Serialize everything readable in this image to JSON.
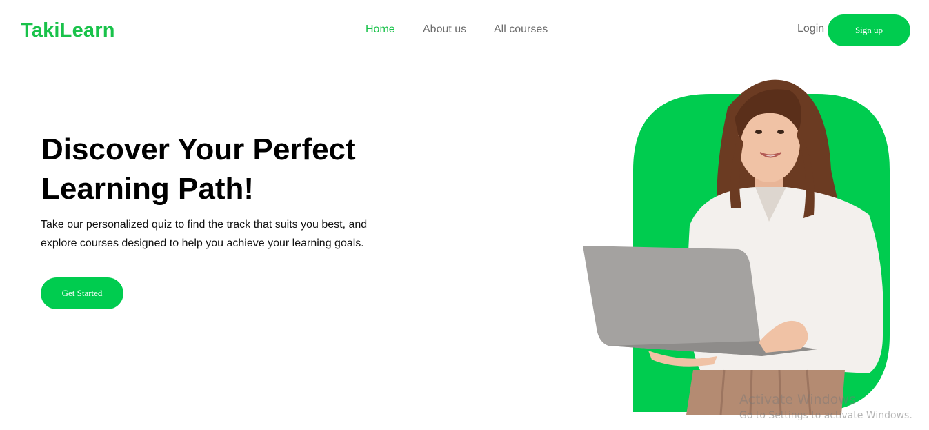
{
  "brand": {
    "name": "TakiLearn",
    "accent_color": "#00cc4f"
  },
  "nav": {
    "items": [
      {
        "label": "Home",
        "active": true
      },
      {
        "label": "About us",
        "active": false
      },
      {
        "label": "All courses",
        "active": false
      }
    ]
  },
  "auth": {
    "login_label": "Login",
    "signup_label": "Sign up"
  },
  "hero": {
    "title_line1": "Discover Your Perfect",
    "title_line2": "Learning Path!",
    "description": "Take our personalized quiz to find the track that suits you best, and explore courses designed to help you achieve your learning goals.",
    "cta_label": "Get Started",
    "image_icon": "woman-with-laptop-illustration"
  },
  "os_watermark": {
    "title": "Activate Windows",
    "subtitle": "Go to Settings to activate Windows."
  }
}
